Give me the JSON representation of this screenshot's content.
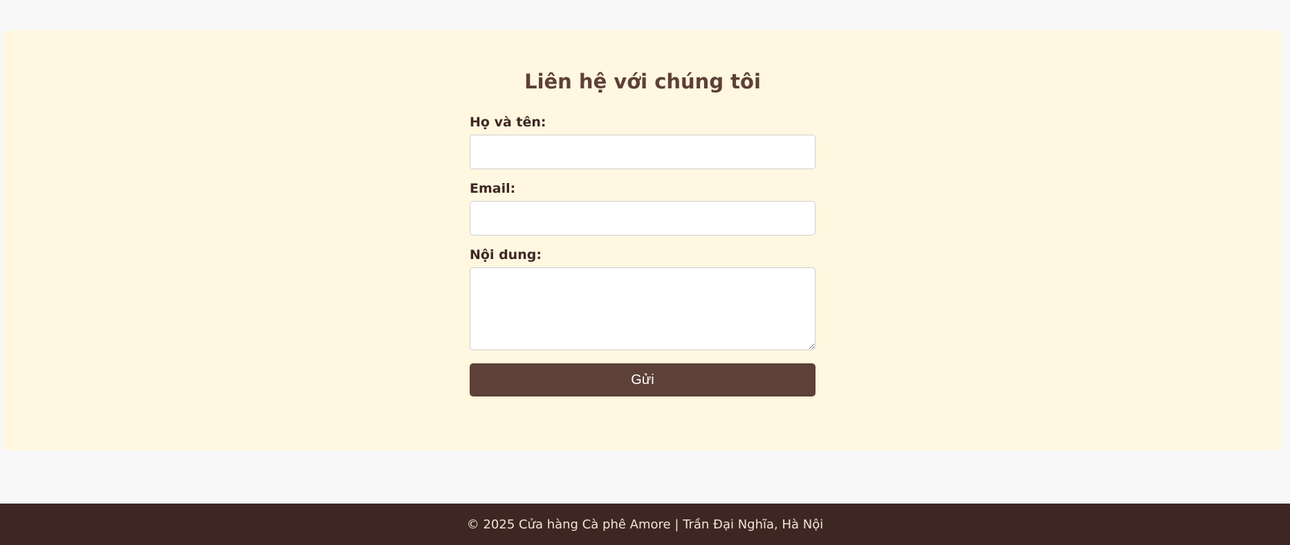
{
  "contact": {
    "title": "Liên hệ với chúng tôi",
    "name_label": "Họ và tên:",
    "name_value": "",
    "email_label": "Email:",
    "email_value": "",
    "message_label": "Nội dung:",
    "message_value": "",
    "submit_label": "Gửi"
  },
  "footer": {
    "text": "© 2025 Cửa hàng Cà phê Amore | Trần Đại Nghĩa, Hà Nội"
  },
  "colors": {
    "page_background": "#f8f8f8",
    "section_background": "#fff7df",
    "brand_brown": "#5d4037",
    "footer_background": "#3e2723"
  }
}
